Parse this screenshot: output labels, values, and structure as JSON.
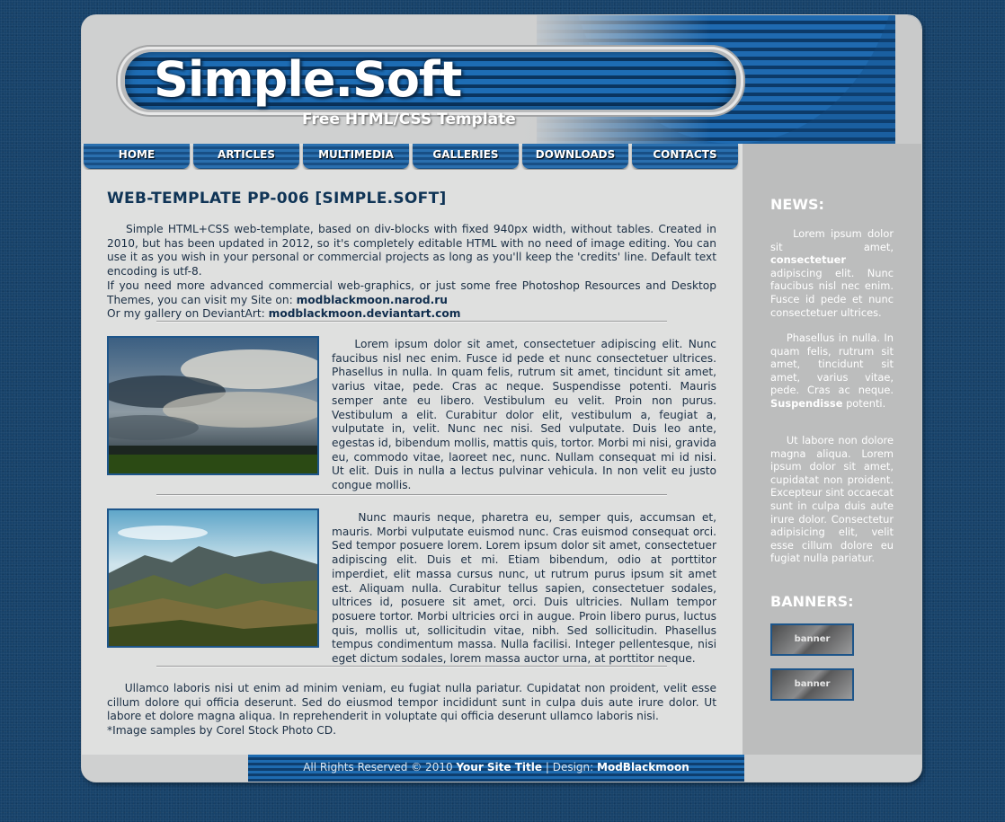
{
  "header": {
    "site_title": "Simple.Soft",
    "subtitle": "Free HTML/CSS Template"
  },
  "nav": {
    "items": [
      {
        "label": "HOME"
      },
      {
        "label": "ARTICLES"
      },
      {
        "label": "MULTIMEDIA"
      },
      {
        "label": "GALLERIES"
      },
      {
        "label": "DOWNLOADS"
      },
      {
        "label": "CONTACTS"
      }
    ]
  },
  "main": {
    "title": "WEB-TEMPLATE PP-006 [SIMPLE.SOFT]",
    "intro_1": "Simple HTML+CSS web-template, based on div-blocks with fixed 940px width, without tables. Created in 2010, but has been updated in 2012, so it's completely editable HTML with no need of image editing. You can use it as you wish in your personal or commercial projects as long as you'll keep the 'credits' line. Default text encoding is utf-8.",
    "intro_2": "If you need more advanced commercial web-graphics, or just some free Photoshop Resources and Desktop Themes, you can visit my Site on:",
    "intro_link_1": "modblackmoon.narod.ru",
    "intro_3": "Or my gallery on DeviantArt:",
    "intro_link_2": "modblackmoon.deviantart.com",
    "article_1": "Lorem ipsum dolor sit amet, consectetuer adipiscing elit. Nunc faucibus nisl nec enim. Fusce id pede et nunc consectetuer ultrices. Phasellus in nulla. In quam felis, rutrum sit amet, tincidunt sit amet, varius vitae, pede. Cras ac neque. Suspendisse potenti. Mauris semper ante eu libero. Vestibulum eu velit. Proin non purus. Vestibulum a elit. Curabitur dolor elit, vestibulum a, feugiat a, vulputate in, velit. Nunc nec nisi. Sed vulputate. Duis leo ante, egestas id, bibendum mollis, mattis quis, tortor. Morbi mi nisi, gravida eu, commodo vitae, laoreet nec, nunc. Nullam consequat mi id nisi. Ut elit. Duis in nulla a lectus pulvinar vehicula. In non velit eu justo congue mollis.",
    "article_2": "Nunc mauris neque, pharetra eu, semper quis, accumsan et, mauris. Morbi vulputate euismod nunc. Cras euismod consequat orci. Sed tempor posuere lorem. Lorem ipsum dolor sit amet, consectetuer adipiscing elit. Duis et mi. Etiam bibendum, odio at porttitor imperdiet, elit massa cursus nunc, ut rutrum purus ipsum sit amet est. Aliquam nulla. Curabitur tellus sapien, consectetuer sodales, ultrices id, posuere sit amet, orci. Duis ultricies. Nullam tempor posuere tortor. Morbi ultricies orci in augue. Proin libero purus, luctus quis, mollis ut, sollicitudin vitae, nibh. Sed sollicitudin. Phasellus tempus condimentum massa. Nulla facilisi. Integer pellentesque, nisi eget dictum sodales, lorem massa auctor urna, at porttitor neque.",
    "closing": "Ullamco laboris nisi ut enim ad minim veniam, eu fugiat nulla pariatur. Cupidatat non proident, velit esse cillum dolore qui officia deserunt. Sed do eiusmod tempor incididunt sunt in culpa duis aute irure dolor. Ut labore et dolore magna aliqua. In reprehenderit in voluptate qui officia deserunt ullamco laboris nisi.",
    "note": "*Image samples by Corel Stock Photo CD."
  },
  "sidebar": {
    "news_heading": "NEWS:",
    "news_1_a": "Lorem ipsum dolor sit amet,",
    "news_1_b": "consectetuer",
    "news_1_c": "adipiscing elit. Nunc faucibus nisl nec enim. Fusce id pede et nunc consectetuer ultrices.",
    "news_2_a": "Phasellus in nulla. In quam felis, rutrum sit amet, tincidunt sit amet, varius vitae, pede. Cras ac neque.",
    "news_2_b": "Suspendisse",
    "news_2_c": "potenti.",
    "news_3": "Ut labore non dolore magna aliqua. Lorem ipsum dolor sit amet, cupidatat non proident. Excepteur sint occaecat sunt in culpa duis aute irure dolor. Consectetur adipisicing elit, velit esse cillum dolore eu fugiat nulla pariatur.",
    "banners_heading": "BANNERS:",
    "banners": [
      "banner",
      "banner"
    ]
  },
  "footer": {
    "prefix": "All Rights Reserved © 2010",
    "site": "Your Site Title",
    "mid": "| Design:",
    "designer": "ModBlackmoon"
  }
}
